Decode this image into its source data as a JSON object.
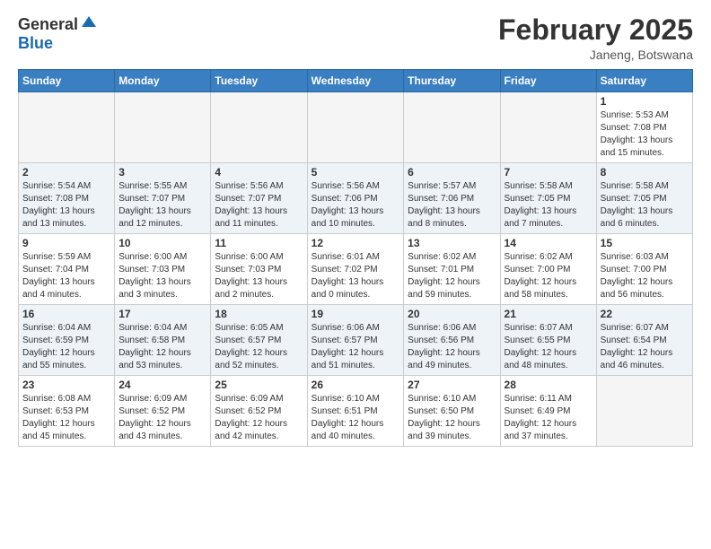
{
  "header": {
    "logo_general": "General",
    "logo_blue": "Blue",
    "month_title": "February 2025",
    "location": "Janeng, Botswana"
  },
  "weekdays": [
    "Sunday",
    "Monday",
    "Tuesday",
    "Wednesday",
    "Thursday",
    "Friday",
    "Saturday"
  ],
  "weeks": [
    [
      {
        "day": "",
        "empty": true
      },
      {
        "day": "",
        "empty": true
      },
      {
        "day": "",
        "empty": true
      },
      {
        "day": "",
        "empty": true
      },
      {
        "day": "",
        "empty": true
      },
      {
        "day": "",
        "empty": true
      },
      {
        "day": "1",
        "sunrise": "5:53 AM",
        "sunset": "7:08 PM",
        "daylight": "13 hours and 15 minutes."
      }
    ],
    [
      {
        "day": "2",
        "sunrise": "5:54 AM",
        "sunset": "7:08 PM",
        "daylight": "13 hours and 13 minutes."
      },
      {
        "day": "3",
        "sunrise": "5:55 AM",
        "sunset": "7:07 PM",
        "daylight": "13 hours and 12 minutes."
      },
      {
        "day": "4",
        "sunrise": "5:56 AM",
        "sunset": "7:07 PM",
        "daylight": "13 hours and 11 minutes."
      },
      {
        "day": "5",
        "sunrise": "5:56 AM",
        "sunset": "7:06 PM",
        "daylight": "13 hours and 10 minutes."
      },
      {
        "day": "6",
        "sunrise": "5:57 AM",
        "sunset": "7:06 PM",
        "daylight": "13 hours and 8 minutes."
      },
      {
        "day": "7",
        "sunrise": "5:58 AM",
        "sunset": "7:05 PM",
        "daylight": "13 hours and 7 minutes."
      },
      {
        "day": "8",
        "sunrise": "5:58 AM",
        "sunset": "7:05 PM",
        "daylight": "13 hours and 6 minutes."
      }
    ],
    [
      {
        "day": "9",
        "sunrise": "5:59 AM",
        "sunset": "7:04 PM",
        "daylight": "13 hours and 4 minutes."
      },
      {
        "day": "10",
        "sunrise": "6:00 AM",
        "sunset": "7:03 PM",
        "daylight": "13 hours and 3 minutes."
      },
      {
        "day": "11",
        "sunrise": "6:00 AM",
        "sunset": "7:03 PM",
        "daylight": "13 hours and 2 minutes."
      },
      {
        "day": "12",
        "sunrise": "6:01 AM",
        "sunset": "7:02 PM",
        "daylight": "13 hours and 0 minutes."
      },
      {
        "day": "13",
        "sunrise": "6:02 AM",
        "sunset": "7:01 PM",
        "daylight": "12 hours and 59 minutes."
      },
      {
        "day": "14",
        "sunrise": "6:02 AM",
        "sunset": "7:00 PM",
        "daylight": "12 hours and 58 minutes."
      },
      {
        "day": "15",
        "sunrise": "6:03 AM",
        "sunset": "7:00 PM",
        "daylight": "12 hours and 56 minutes."
      }
    ],
    [
      {
        "day": "16",
        "sunrise": "6:04 AM",
        "sunset": "6:59 PM",
        "daylight": "12 hours and 55 minutes."
      },
      {
        "day": "17",
        "sunrise": "6:04 AM",
        "sunset": "6:58 PM",
        "daylight": "12 hours and 53 minutes."
      },
      {
        "day": "18",
        "sunrise": "6:05 AM",
        "sunset": "6:57 PM",
        "daylight": "12 hours and 52 minutes."
      },
      {
        "day": "19",
        "sunrise": "6:06 AM",
        "sunset": "6:57 PM",
        "daylight": "12 hours and 51 minutes."
      },
      {
        "day": "20",
        "sunrise": "6:06 AM",
        "sunset": "6:56 PM",
        "daylight": "12 hours and 49 minutes."
      },
      {
        "day": "21",
        "sunrise": "6:07 AM",
        "sunset": "6:55 PM",
        "daylight": "12 hours and 48 minutes."
      },
      {
        "day": "22",
        "sunrise": "6:07 AM",
        "sunset": "6:54 PM",
        "daylight": "12 hours and 46 minutes."
      }
    ],
    [
      {
        "day": "23",
        "sunrise": "6:08 AM",
        "sunset": "6:53 PM",
        "daylight": "12 hours and 45 minutes."
      },
      {
        "day": "24",
        "sunrise": "6:09 AM",
        "sunset": "6:52 PM",
        "daylight": "12 hours and 43 minutes."
      },
      {
        "day": "25",
        "sunrise": "6:09 AM",
        "sunset": "6:52 PM",
        "daylight": "12 hours and 42 minutes."
      },
      {
        "day": "26",
        "sunrise": "6:10 AM",
        "sunset": "6:51 PM",
        "daylight": "12 hours and 40 minutes."
      },
      {
        "day": "27",
        "sunrise": "6:10 AM",
        "sunset": "6:50 PM",
        "daylight": "12 hours and 39 minutes."
      },
      {
        "day": "28",
        "sunrise": "6:11 AM",
        "sunset": "6:49 PM",
        "daylight": "12 hours and 37 minutes."
      },
      {
        "day": "",
        "empty": true
      }
    ]
  ],
  "labels": {
    "sunrise": "Sunrise: ",
    "sunset": "Sunset: ",
    "daylight": "Daylight: "
  }
}
